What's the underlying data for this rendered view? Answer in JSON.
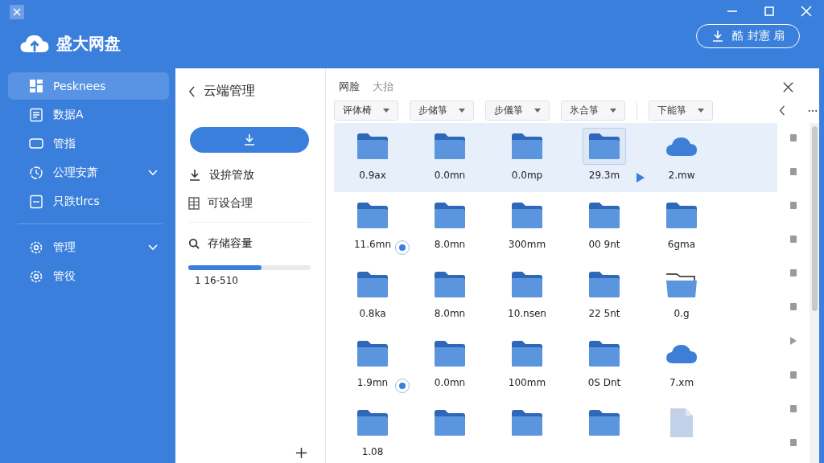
{
  "app": {
    "name": "盛大网盘"
  },
  "sidebar": {
    "groups": [
      {
        "items": [
          {
            "label": "Pesknees",
            "selected": true,
            "expandable": false
          },
          {
            "label": "数据A",
            "selected": false,
            "expandable": false
          },
          {
            "label": "管指",
            "selected": false,
            "expandable": false
          },
          {
            "label": "公理安萧",
            "selected": false,
            "expandable": true
          },
          {
            "label": "只跌tlrcs",
            "selected": false,
            "expandable": false
          }
        ]
      },
      {
        "items": [
          {
            "label": "管理",
            "selected": false,
            "expandable": true
          },
          {
            "label": "管役",
            "selected": false,
            "expandable": false
          }
        ]
      }
    ]
  },
  "header": {
    "action_button": "酷 封憲 扇"
  },
  "panel": {
    "title": "云端管理",
    "menu": [
      {
        "label": "设拚管放",
        "kind": "download"
      },
      {
        "label": "可设合理",
        "kind": "grid"
      }
    ],
    "storage": {
      "label": "存储容量",
      "level": 0.6,
      "reading": "1 16-510"
    }
  },
  "main": {
    "breadcrumb": [
      "网脸",
      "大抬"
    ],
    "filters": [
      "评体椅",
      "步储箏",
      "步儀箏",
      "氷合箏",
      "下能箏"
    ],
    "rows": [
      {
        "selected": true,
        "items": [
          {
            "kind": "folder",
            "label": "0.9ax",
            "selected": false,
            "badge": false,
            "arrow": false
          },
          {
            "kind": "folder",
            "label": "0.0mn",
            "selected": false,
            "badge": false,
            "arrow": false
          },
          {
            "kind": "folder",
            "label": "0.0mp",
            "selected": false,
            "badge": false,
            "arrow": false
          },
          {
            "kind": "folder",
            "label": "29.3m",
            "selected": true,
            "badge": false,
            "arrow": true
          },
          {
            "kind": "cloud",
            "label": "2.mw",
            "selected": false,
            "badge": false,
            "arrow": false
          }
        ]
      },
      {
        "selected": false,
        "items": [
          {
            "kind": "folder",
            "label": "11.6mn",
            "selected": false,
            "badge": true,
            "arrow": false
          },
          {
            "kind": "folder",
            "label": "8.0mn",
            "selected": false,
            "badge": false,
            "arrow": false
          },
          {
            "kind": "folder",
            "label": "300mm",
            "selected": false,
            "badge": false,
            "arrow": false
          },
          {
            "kind": "folder",
            "label": "00 9nt",
            "selected": false,
            "badge": false,
            "arrow": false
          },
          {
            "kind": "folder",
            "label": "6gma",
            "selected": false,
            "badge": false,
            "arrow": false
          }
        ]
      },
      {
        "selected": false,
        "items": [
          {
            "kind": "folder",
            "label": "0.8ka",
            "selected": false,
            "badge": false,
            "arrow": false
          },
          {
            "kind": "folder",
            "label": "8.0mn",
            "selected": false,
            "badge": false,
            "arrow": false
          },
          {
            "kind": "folder",
            "label": "10.nsen",
            "selected": false,
            "badge": false,
            "arrow": false
          },
          {
            "kind": "folder",
            "label": "22 5nt",
            "selected": false,
            "badge": false,
            "arrow": false
          },
          {
            "kind": "open-folder",
            "label": "0.g",
            "selected": false,
            "badge": false,
            "arrow": false
          }
        ]
      },
      {
        "selected": false,
        "items": [
          {
            "kind": "folder",
            "label": "1.9mn",
            "selected": false,
            "badge": true,
            "arrow": false
          },
          {
            "kind": "folder",
            "label": "0.0mn",
            "selected": false,
            "badge": false,
            "arrow": false
          },
          {
            "kind": "folder",
            "label": "100mm",
            "selected": false,
            "badge": false,
            "arrow": false
          },
          {
            "kind": "folder",
            "label": "0S Dnt",
            "selected": false,
            "badge": false,
            "arrow": false
          },
          {
            "kind": "cloud",
            "label": "7.xm",
            "selected": false,
            "badge": false,
            "arrow": false
          }
        ]
      },
      {
        "selected": false,
        "items": [
          {
            "kind": "folder",
            "label": "1.08",
            "selected": false,
            "badge": false,
            "arrow": false
          },
          {
            "kind": "folder",
            "selected": false,
            "badge": false,
            "arrow": false
          },
          {
            "kind": "folder",
            "selected": false,
            "badge": false,
            "arrow": false
          },
          {
            "kind": "folder",
            "selected": false,
            "badge": false,
            "arrow": false
          },
          {
            "kind": "file",
            "selected": false,
            "badge": false,
            "arrow": false
          }
        ]
      }
    ]
  }
}
